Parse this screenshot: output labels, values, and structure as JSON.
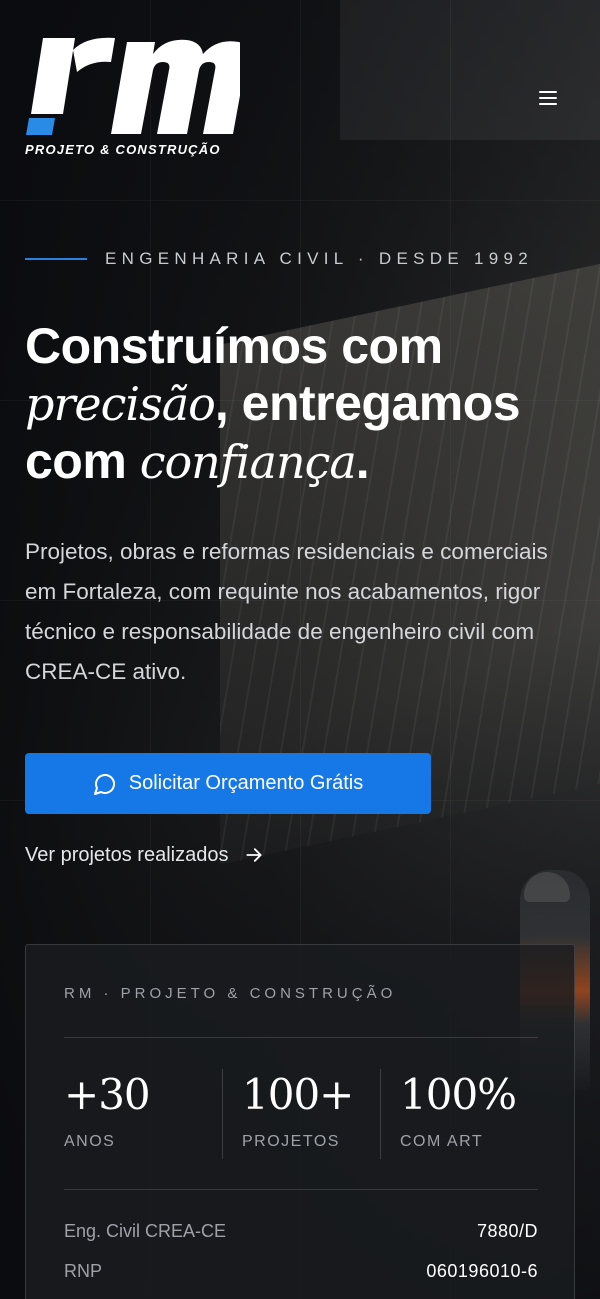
{
  "header": {
    "logo_tagline": "PROJETO & CONSTRUÇÃO",
    "menu_icon": "hamburger-menu-icon"
  },
  "hero": {
    "eyebrow": "ENGENHARIA CIVIL · DESDE 1992",
    "headline_part1": "Construímos com ",
    "headline_italic1": "precisão",
    "headline_part2": ", entregamos com ",
    "headline_italic2": "confiança",
    "headline_end": ".",
    "lead": "Projetos, obras e reformas residenciais e comerciais em Fortaleza, com requinte nos acabamentos, rigor técnico e responsabilidade de engenheiro civil com CREA-CE ativo.",
    "cta_label": "Solicitar Orçamento Grátis",
    "cta_icon": "chat-bubble-icon",
    "secondary_link": "Ver projetos realizados",
    "secondary_icon": "arrow-right-icon"
  },
  "card": {
    "title": "RM · PROJETO & CONSTRUÇÃO",
    "stats": [
      {
        "value": "+30",
        "label": "ANOS"
      },
      {
        "value": "100+",
        "label": "PROJETOS"
      },
      {
        "value": "100%",
        "label": "COM ART"
      }
    ],
    "rows": [
      {
        "key": "Eng. Civil CREA-CE",
        "value": "7880/D"
      },
      {
        "key": "RNP",
        "value": "060196010-6"
      }
    ]
  },
  "colors": {
    "accent": "#1677e6",
    "logo_accent": "#2a8be6",
    "background": "#0c0d10"
  }
}
